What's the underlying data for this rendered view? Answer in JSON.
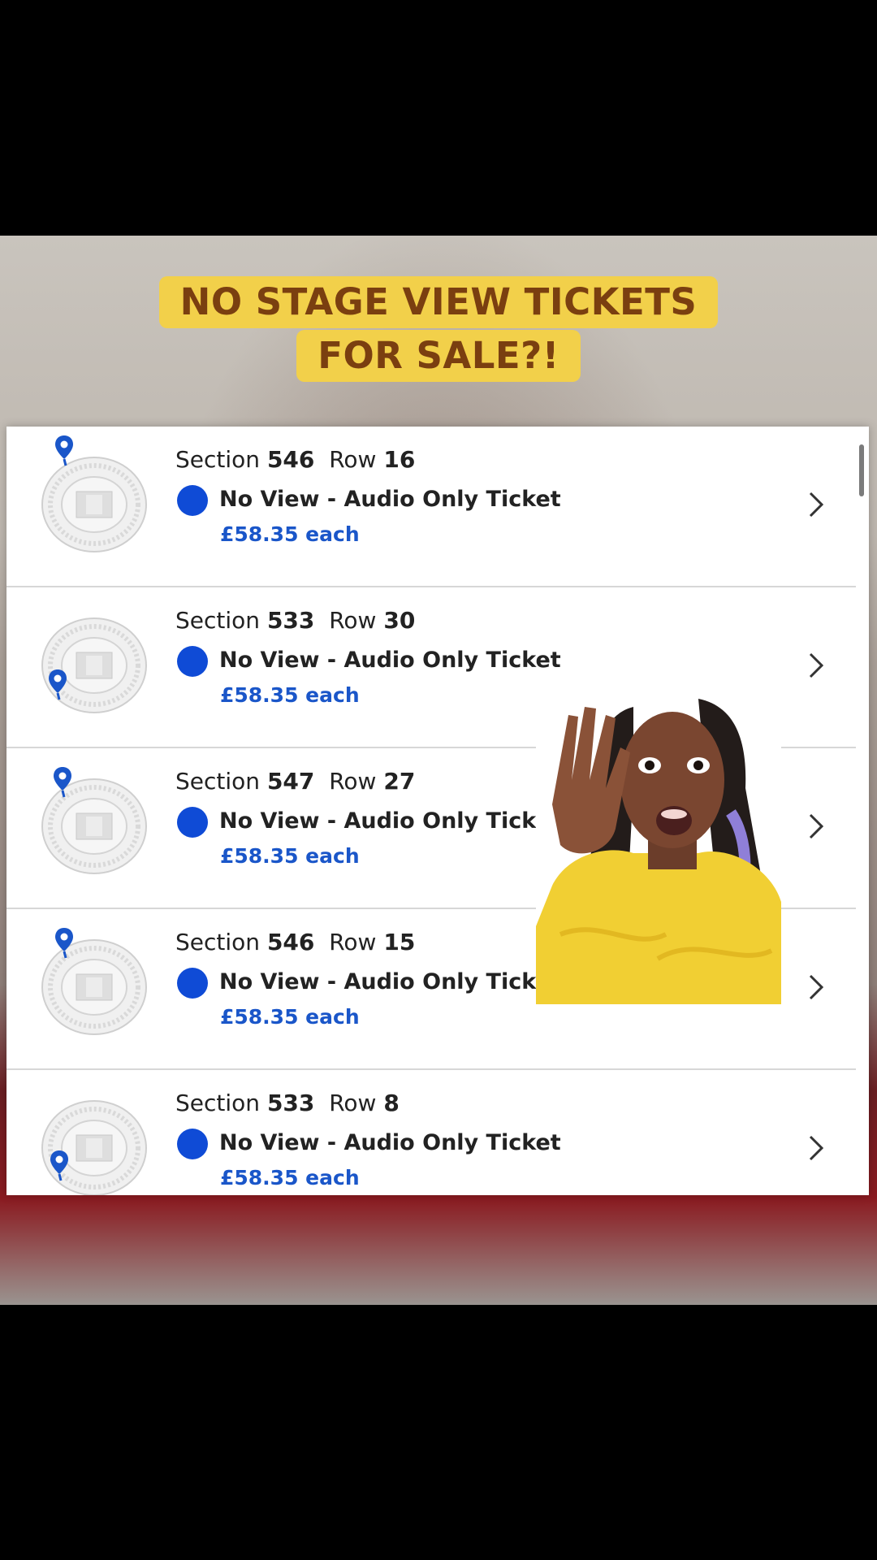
{
  "caption": {
    "line1": "NO STAGE VIEW TICKETS",
    "line2": "FOR SALE?!"
  },
  "colors": {
    "caption_bg": "#f2d04a",
    "caption_text": "#7a3f10",
    "accent_blue": "#0f4bd6",
    "price_blue": "#1a56c9"
  },
  "listings": [
    {
      "section_label": "Section",
      "section": "546",
      "row_label": "Row",
      "row": "16",
      "ticket_type": "No View - Audio Only Ticket",
      "price": "£58.35 each",
      "pin_position": "top-left"
    },
    {
      "section_label": "Section",
      "section": "533",
      "row_label": "Row",
      "row": "30",
      "ticket_type": "No View - Audio Only Ticket",
      "price": "£58.35 each",
      "pin_position": "left"
    },
    {
      "section_label": "Section",
      "section": "547",
      "row_label": "Row",
      "row": "27",
      "ticket_type": "No View - Audio Only Ticket",
      "price": "£58.35 each",
      "pin_position": "top-left"
    },
    {
      "section_label": "Section",
      "section": "546",
      "row_label": "Row",
      "row": "15",
      "ticket_type": "No View - Audio Only Ticket",
      "price": "£58.35 each",
      "pin_position": "top-left"
    },
    {
      "section_label": "Section",
      "section": "533",
      "row_label": "Row",
      "row": "8",
      "ticket_type": "No View - Audio Only Ticket",
      "price": "£58.35 each",
      "pin_position": "left"
    }
  ],
  "icons": {
    "stadium": "stadium-map-icon",
    "pin": "location-pin-icon",
    "availability": "blue-dot-icon",
    "chevron": "chevron-right-icon"
  }
}
